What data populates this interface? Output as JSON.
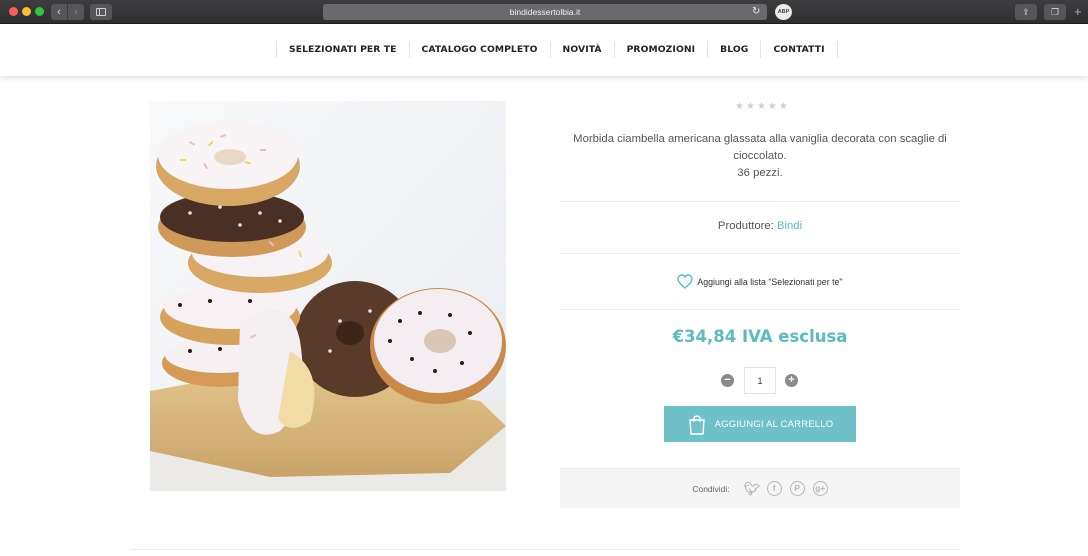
{
  "browser": {
    "url": "bindidessertolbia.it",
    "adblock_label": "ABP"
  },
  "nav": {
    "items": [
      "SELEZIONATI PER TE",
      "CATALOGO COMPLETO",
      "NOVITÀ",
      "PROMOZIONI",
      "BLOG",
      "CONTATTI"
    ]
  },
  "product": {
    "image_alt": "ciambelle glassate",
    "rating": 0,
    "rating_max": 5,
    "description_line1": "Morbida ciambella americana glassata alla vaniglia decorata con scaglie di",
    "description_line2": "cioccolato.",
    "description_line3": "36 pezzi.",
    "producer_label": "Produttore:",
    "producer_name": "Bindi",
    "wishlist_label": "Aggiungi alla lista \"Selezionati per te\"",
    "price": "€34,84 IVA esclusa",
    "quantity": "1",
    "add_to_cart_label": "AGGIUNGI AL CARRELLO",
    "share_label": "Condividi:",
    "share_icons": [
      "twitter-icon",
      "facebook-icon",
      "pinterest-icon",
      "google-plus-icon"
    ]
  },
  "colors": {
    "accent": "#5bbac2",
    "cart_button": "#6dc1c7"
  }
}
